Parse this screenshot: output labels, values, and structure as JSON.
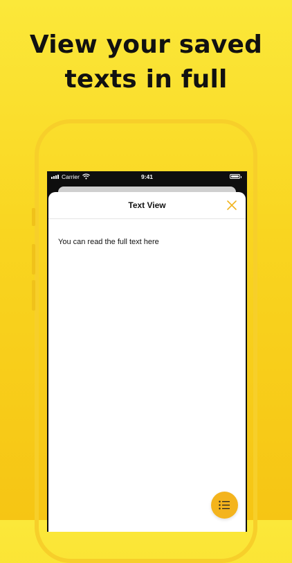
{
  "headline": {
    "line1": "View your saved",
    "line2": "texts in full"
  },
  "status_bar": {
    "carrier": "Carrier",
    "time": "9:41",
    "icons": [
      "signal-icon",
      "wifi-icon",
      "battery-icon"
    ]
  },
  "sheet": {
    "title": "Text View",
    "body": "You can read the full text here",
    "close_icon": "close-icon"
  },
  "fab": {
    "icon": "list-icon"
  },
  "colors": {
    "background_top": "#fbe83a",
    "background_bottom": "#f6c514",
    "accent": "#f4b41d",
    "close_icon": "#f0b41e"
  }
}
